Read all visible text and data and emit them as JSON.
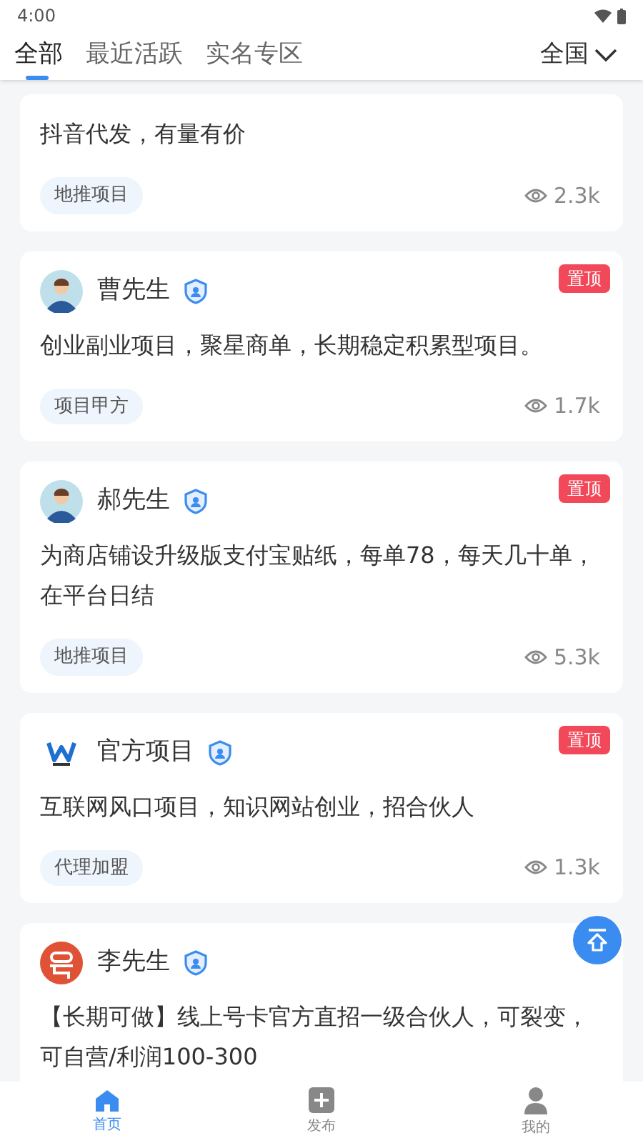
{
  "status_bar": {
    "time": "4:00"
  },
  "tabs": [
    {
      "label": "全部",
      "selected": true
    },
    {
      "label": "最近活跃",
      "selected": false
    },
    {
      "label": "实名专区",
      "selected": false
    }
  ],
  "region": {
    "label": "全国"
  },
  "posts": [
    {
      "pinned": false,
      "text": "抖音代发，有量有价",
      "tag": "地推项目",
      "views": "2.3k"
    },
    {
      "author": {
        "name": "曹先生",
        "kind": "person",
        "verified": true
      },
      "pinned": true,
      "pin_label": "置顶",
      "text": "创业副业项目，聚星商单，长期稳定积累型项目。",
      "tag": "项目甲方",
      "views": "1.7k"
    },
    {
      "author": {
        "name": "郝先生",
        "kind": "person",
        "verified": true
      },
      "pinned": true,
      "pin_label": "置顶",
      "text": "为商店铺设升级版支付宝贴纸，每单78，每天几十单，在平台日结",
      "tag": "地推项目",
      "views": "5.3k"
    },
    {
      "author": {
        "name": "官方项目",
        "kind": "logo",
        "verified": true
      },
      "pinned": true,
      "pin_label": "置顶",
      "text": "互联网风口项目，知识网站创业，招合伙人",
      "tag": "代理加盟",
      "views": "1.3k"
    },
    {
      "author": {
        "name": "李先生",
        "kind": "badge",
        "verified": true
      },
      "pinned": false,
      "text": "【长期可做】线上号卡官方直招一级合伙人，可裂变，可自营/利润100-300"
    }
  ],
  "bottom_nav": [
    {
      "label": "首页",
      "selected": true
    },
    {
      "label": "发布",
      "selected": false
    },
    {
      "label": "我的",
      "selected": false
    }
  ]
}
